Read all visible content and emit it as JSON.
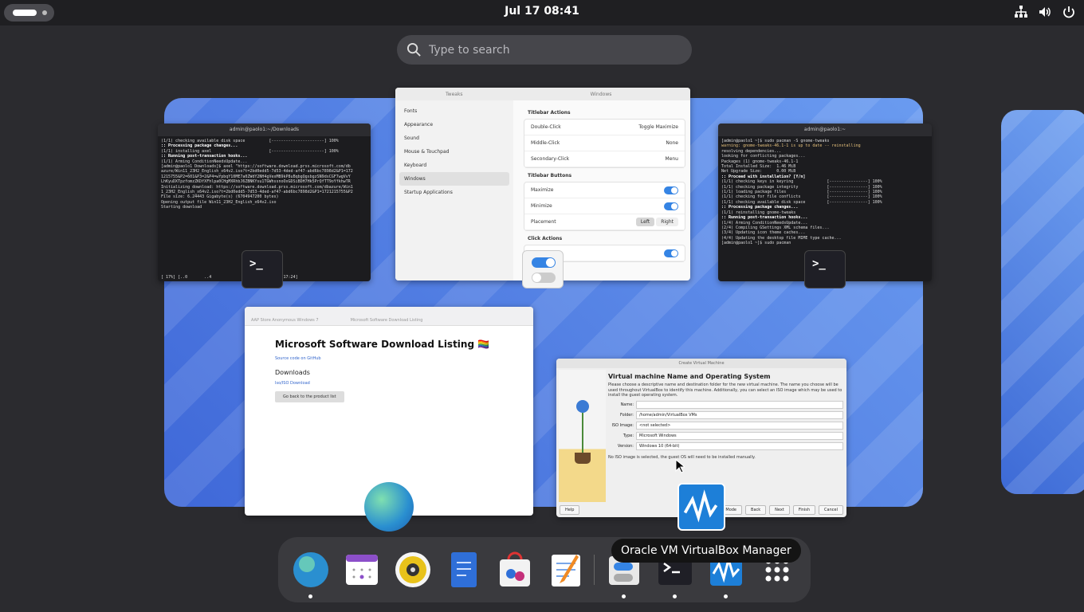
{
  "topbar": {
    "clock": "Jul 17  08:41"
  },
  "search": {
    "placeholder": "Type to search"
  },
  "term1": {
    "title": "admin@paolo1:~/Downloads",
    "lines": [
      "(1/1) checking available disk space          [----------------------] 100%",
      ":: Processing package changes...",
      "(1/1) installing axel                        [----------------------] 100%",
      ":: Running post-transaction hooks...",
      "(1/1) Arming ConditionNeedsUpdate...",
      "[admin@paolo1 Downloads]$ axel \"https://software.download.prss.microsoft.com/db",
      "azure/Win11_23H2_English_x64v2.iso?t=2bd0edd5-7d53-4ded-af47-abd6bc7898d2&P1=172",
      "1215755&P2=601&P3=2&P4=wYpbqY10ME7a0ZWdY2NH4gVexMB9kP8uBqbgQgsbgzSN9dsCGF7wgVvY",
      "LhKyuDXTpzfomzZKDfXFhlpa0CHgMXRhbJ6ZBNKYsu1TGWhssnoOxGDSiBDH7Hk5PrQfTT9oYfkhwTR",
      "Initializing download: https://software.download.prss.microsoft.com/dbazure/Win1",
      "1_23H2_English_x64v2.iso?t=2bd0edd5-7d53-4ded-af47-abd6bc7898d2&P1=1721215755&P2",
      "File size: 6.24443 Gigabyte(s) (6704947200 bytes)",
      "Opening output file Win11_23H2_English_x64v2.iso",
      "Starting download"
    ],
    "status": "[ 17%] [..0       ..4              ]  [  5.1MB/s] [17:24]"
  },
  "tweaks": {
    "title": "Tweaks",
    "section": "Windows",
    "sidebar": [
      "Fonts",
      "Appearance",
      "Sound",
      "Mouse & Touchpad",
      "Keyboard",
      "Windows",
      "Startup Applications"
    ],
    "groups": {
      "actions": "Titlebar Actions",
      "buttons": "Titlebar Buttons",
      "focus": "Click Actions"
    },
    "actions": [
      {
        "label": "Double-Click",
        "value": "Toggle Maximize"
      },
      {
        "label": "Middle-Click",
        "value": "None"
      },
      {
        "label": "Secondary-Click",
        "value": "Menu"
      }
    ],
    "buttons": [
      {
        "label": "Maximize"
      },
      {
        "label": "Minimize"
      },
      {
        "label": "Placement",
        "left": "Left",
        "right": "Right"
      }
    ]
  },
  "term2": {
    "title": "admin@paolo1:~",
    "lines": [
      "[admin@paolo1 ~]$ sudo pacman -S gnome-tweaks",
      "warning: gnome-tweaks-46.1-1 is up to date -- reinstalling",
      "resolving dependencies...",
      "looking for conflicting packages...",
      "",
      "Packages (1) gnome-tweaks-46.1-1",
      "",
      "Total Installed Size:  1.46 MiB",
      "Net Upgrade Size:      0.00 MiB",
      "",
      ":: Proceed with installation? [Y/n]",
      "(1/1) checking keys in keyring              [----------------] 100%",
      "(1/1) checking package integrity            [----------------] 100%",
      "(1/1) loading package files                 [----------------] 100%",
      "(1/1) checking for file conflicts           [----------------] 100%",
      "(1/1) checking available disk space         [----------------] 100%",
      ":: Processing package changes...",
      "(1/1) reinstalling gnome-tweaks",
      ":: Running post-transaction hooks...",
      "(1/4) Arming ConditionNeedsUpdate...",
      "(2/4) Compiling GSettings XML schema files...",
      "(3/4) Updating icon theme caches...",
      "(4/4) Updating the desktop file MIME type cache...",
      "[admin@paolo1 ~]$ sudo pacman"
    ]
  },
  "browser": {
    "tab1": "AAP Store Anonymous Windows 7",
    "tab2": "Microsoft Software Download Listing",
    "heading": "Microsoft Software Download Listing 🏳️‍🌈",
    "source": "Source code on GitHub",
    "downloads": "Downloads",
    "iso": "Iso/ISO Download",
    "back": "Go back to the product list"
  },
  "vbox": {
    "window_title": "Create Virtual Machine",
    "heading": "Virtual machine Name and Operating System",
    "description": "Please choose a descriptive name and destination folder for the new virtual machine. The name you choose will be used throughout VirtualBox to identify this machine. Additionally, you can select an ISO image which may be used to install the guest operating system.",
    "fields": [
      {
        "label": "Name:",
        "value": ""
      },
      {
        "label": "Folder:",
        "value": "/home/admin/VirtualBox VMs"
      },
      {
        "label": "ISO Image:",
        "value": "<not selected>"
      },
      {
        "label": "Type:",
        "value": "Microsoft Windows"
      },
      {
        "label": "Version:",
        "value": "Windows 10 (64-bit)"
      }
    ],
    "unattended": "No ISO image is selected, the guest OS will need to be installed manually.",
    "buttons": {
      "help": "Help",
      "expert": "Expert Mode",
      "back": "Back",
      "next": "Next",
      "finish": "Finish",
      "cancel": "Cancel"
    }
  },
  "dash": {
    "tooltip": "Oracle VM VirtualBox Manager",
    "apps": [
      {
        "icon": "globe-browser-icon",
        "running": true
      },
      {
        "icon": "calendar-icon",
        "running": false
      },
      {
        "icon": "music-player-icon",
        "running": false
      },
      {
        "icon": "text-document-icon",
        "running": false
      },
      {
        "icon": "software-store-icon",
        "running": false
      },
      {
        "icon": "text-editor-icon",
        "running": false
      },
      {
        "icon": "tweaks-icon",
        "running": true
      },
      {
        "icon": "terminal-icon",
        "running": true
      },
      {
        "icon": "virtualbox-icon",
        "running": true
      },
      {
        "icon": "app-grid-icon",
        "running": false
      }
    ]
  },
  "colors": {
    "accent": "#3584e4",
    "panel": "#1f1f22",
    "dash": "#3a3a3e"
  }
}
